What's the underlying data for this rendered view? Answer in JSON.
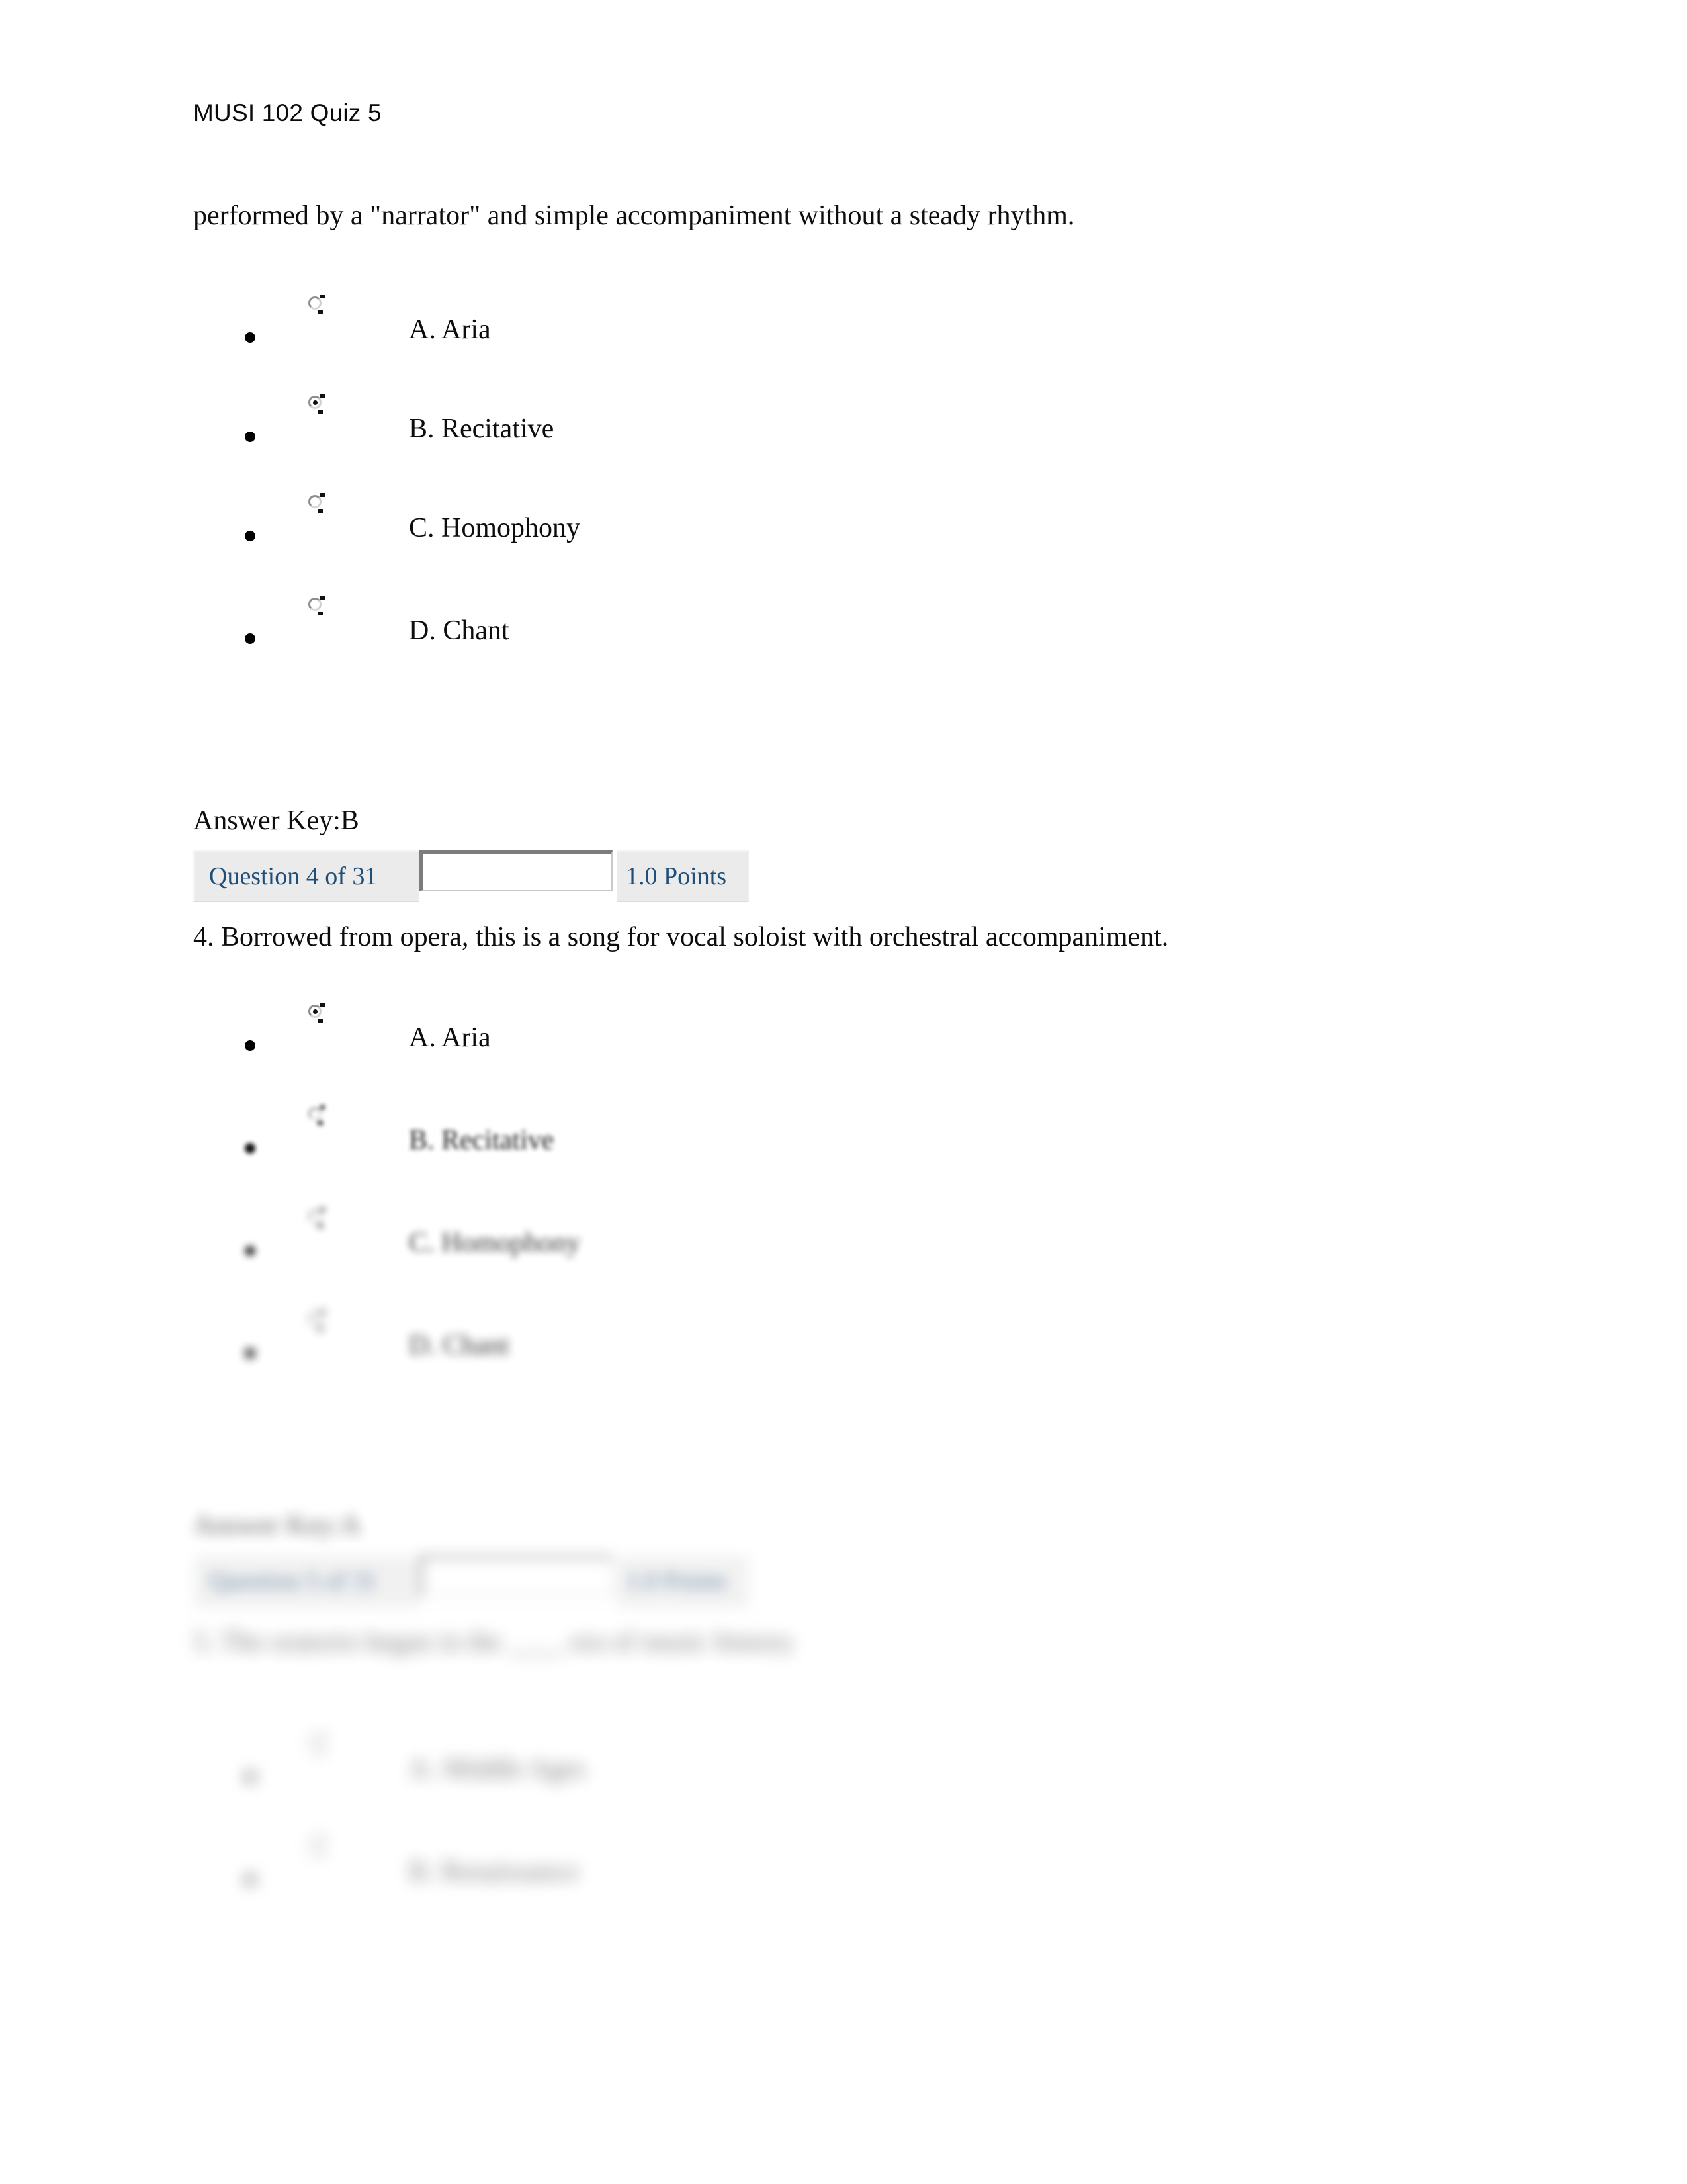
{
  "document": {
    "header": "MUSI 102 Quiz 5"
  },
  "question3": {
    "stem_tail": "performed by a \"narrator\" and simple accompaniment without a steady rhythm.",
    "options": [
      {
        "label": "A. Aria",
        "selected": false
      },
      {
        "label": "B. Recitative",
        "selected": true
      },
      {
        "label": "C. Homophony",
        "selected": false
      },
      {
        "label": "D. Chant",
        "selected": false
      }
    ],
    "answer_key": "Answer Key:B"
  },
  "question4": {
    "meta": {
      "counter": "Question 4 of 31",
      "points": "1.0 Points"
    },
    "stem": "4. Borrowed from opera, this is a song for vocal soloist with orchestral accompaniment.",
    "options": [
      {
        "label": "A. Aria",
        "selected": true
      },
      {
        "label": "B. Recitative",
        "selected": false
      },
      {
        "label": "C. Homophony",
        "selected": false
      },
      {
        "label": "D. Chant",
        "selected": false
      }
    ],
    "answer_key": "Answer Key:A"
  },
  "question5": {
    "meta": {
      "counter": "Question 5 of 31",
      "points": "1.0 Points"
    },
    "stem": "5. The oratorio began in the ____ era of music history.",
    "options": [
      {
        "label": "A. Middle Ages",
        "selected": false
      },
      {
        "label": "B. Renaissance",
        "selected": false
      }
    ]
  },
  "colors": {
    "link_blue": "#1f4e79",
    "cell_gray": "#ebebeb",
    "text_black": "#0d0d0d"
  }
}
